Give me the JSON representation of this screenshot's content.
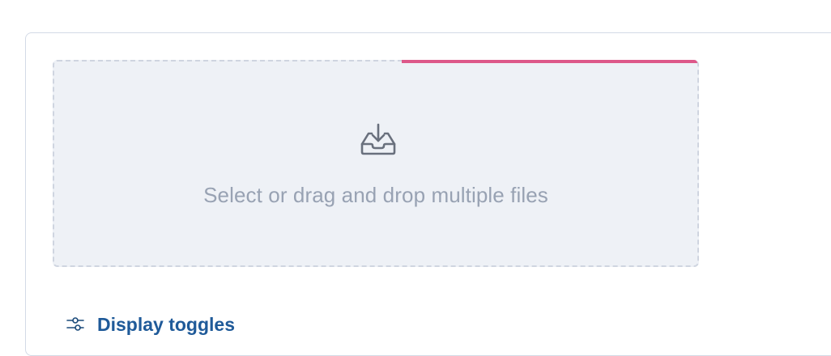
{
  "file_picker": {
    "prompt": "Select or drag and drop multiple files",
    "icon": "inbox-download-icon",
    "progress": {
      "fraction_start": 0.54,
      "fraction_end": 1.0,
      "color": "#dd5889"
    }
  },
  "display_toggles": {
    "label": "Display toggles",
    "icon": "sliders-icon",
    "color": "#1f5a99"
  },
  "colors": {
    "panel_border": "#d3dae6",
    "dropzone_bg": "#eef1f6",
    "dropzone_border": "#cfd5e0",
    "prompt_text": "#98a2b3",
    "icon": "#69707d"
  }
}
